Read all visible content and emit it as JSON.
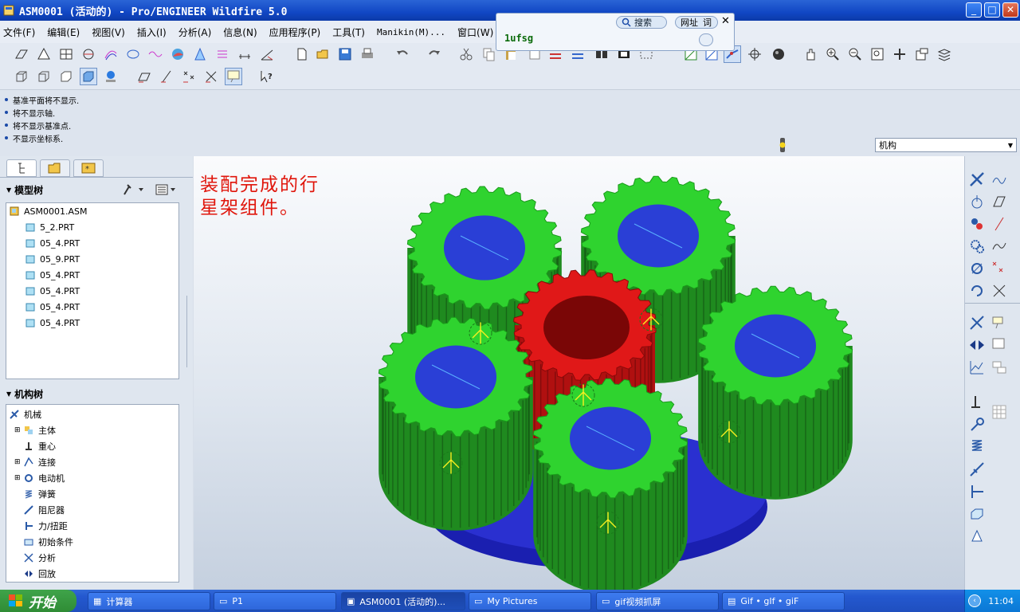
{
  "window": {
    "title": "ASM0001 (活动的) - Pro/ENGINEER Wildfire 5.0",
    "min": "_",
    "max": "□",
    "close": "✕"
  },
  "menu": [
    "文件(F)",
    "编辑(E)",
    "视图(V)",
    "插入(I)",
    "分析(A)",
    "信息(N)",
    "应用程序(P)",
    "工具(T)",
    "Manikin(M)...",
    "窗口(W)"
  ],
  "search_popup": {
    "search_label": "搜索",
    "url_label": "网址",
    "word_label": "词",
    "query": "1ufsg"
  },
  "messages": [
    "基准平面将不显示.",
    "将不显示轴.",
    "将不显示基准点.",
    "不显示坐标系."
  ],
  "mode_select": {
    "value": "机构"
  },
  "model_tree": {
    "header": "模型树",
    "items": [
      "ASM0001.ASM",
      "5_2.PRT",
      "05_4.PRT",
      "05_9.PRT",
      "05_4.PRT",
      "05_4.PRT",
      "05_4.PRT",
      "05_4.PRT"
    ]
  },
  "mechanism_tree": {
    "header": "机构树",
    "items": [
      "机械",
      "主体",
      "重心",
      "连接",
      "电动机",
      "弹簧",
      "阻尼器",
      "力/扭距",
      "初始条件",
      "分析",
      "回放"
    ]
  },
  "annotation": {
    "line1": "装配完成的行",
    "line2": "星架组件。"
  },
  "taskbar": {
    "start": "开始",
    "tasks": [
      "计算器",
      "P1",
      "ASM0001 (活动的)...",
      "My Pictures",
      "gif视频抓屏",
      "Gif • gIf • giF"
    ],
    "clock": "11:04"
  },
  "colors": {
    "gear_green": "#2fd32f",
    "gear_side": "#1f8a1f",
    "sun_red": "#e01818",
    "bore_blue": "#2a3fd6",
    "carrier_blue": "#1a1fb0"
  }
}
